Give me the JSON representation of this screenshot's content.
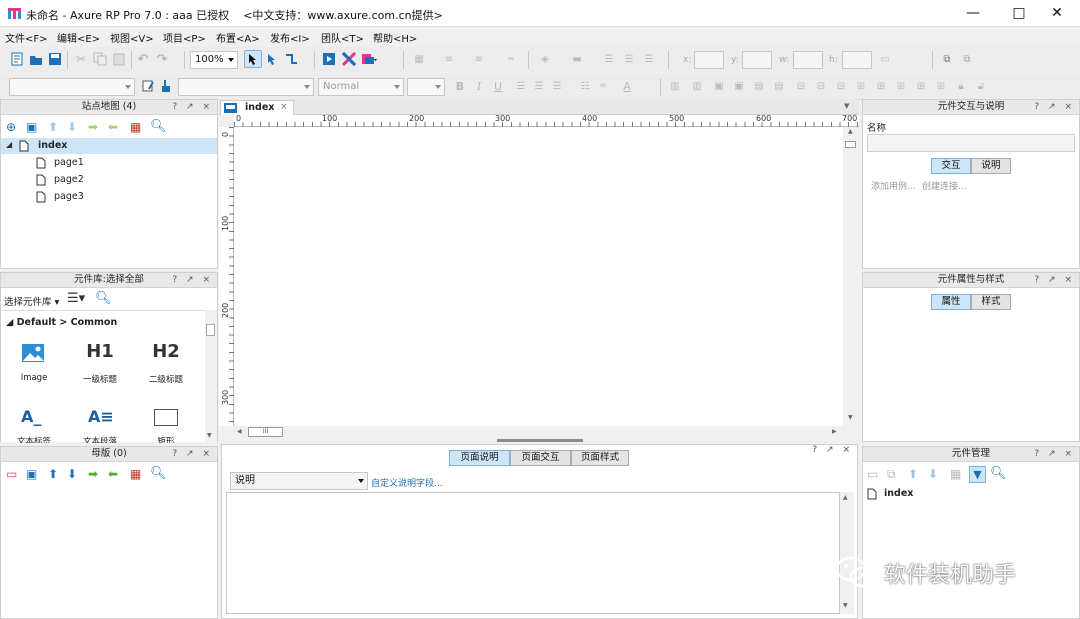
{
  "window": {
    "title": "未命名 - Axure RP Pro 7.0 : aaa 已授权    <中文支持：www.axure.com.cn提供>",
    "min_icon": "minimize-icon",
    "max_icon": "maximize-icon",
    "close_icon": "close-icon"
  },
  "menu": [
    "文件<F>",
    "编辑<E>",
    "视图<V>",
    "项目<P>",
    "布置<A>",
    "发布<I>",
    "团队<T>",
    "帮助<H>"
  ],
  "toolbar": {
    "zoom": "100%",
    "style_value": "Normal",
    "field_x": "x:",
    "field_y": "y:",
    "field_w": "w:",
    "field_h": "h:"
  },
  "sitemap": {
    "title": "站点地图 (4)",
    "ctrls": "? ↗ ×",
    "root": "index",
    "pages": [
      "page1",
      "page2",
      "page3"
    ]
  },
  "library": {
    "title": "元件库:选择全部",
    "ctrls": "? ↗ ×",
    "selector": "选择元件库",
    "group": "Default > Common",
    "items": [
      {
        "icon": "H1",
        "label": "一级标题"
      },
      {
        "icon": "H2",
        "label": "二级标题"
      },
      {
        "label": "Image"
      },
      {
        "label": "文本标签"
      },
      {
        "label": "文本段落"
      },
      {
        "label": "矩形"
      }
    ]
  },
  "masters": {
    "title": "母版 (0)",
    "ctrls": "? ↗ ×"
  },
  "canvas": {
    "tab": "index",
    "ruler_marks": [
      "0",
      "100",
      "200",
      "300",
      "400",
      "500",
      "600",
      "700"
    ],
    "vruler_marks": [
      "0",
      "100",
      "200",
      "300"
    ],
    "scroll_label": "III"
  },
  "pagenotes": {
    "ctrls": "? ↗ ×",
    "tabs": [
      "页面说明",
      "页面交互",
      "页面样式"
    ],
    "active_tab": 0,
    "select_value": "说明",
    "link": "自定义说明字段..."
  },
  "interactions": {
    "title": "元件交互与说明",
    "ctrls": "? ↗ ×",
    "name_label": "名称",
    "tabs": [
      "交互",
      "说明"
    ],
    "hint1": "添加用例...",
    "hint2": "创建连接..."
  },
  "properties": {
    "title": "元件属性与样式",
    "ctrls": "? ↗ ×",
    "tabs": [
      "属性",
      "样式"
    ]
  },
  "widgetmgr": {
    "title": "元件管理",
    "ctrls": "? ↗ ×",
    "item": "index"
  },
  "watermark": "软件装机助手"
}
